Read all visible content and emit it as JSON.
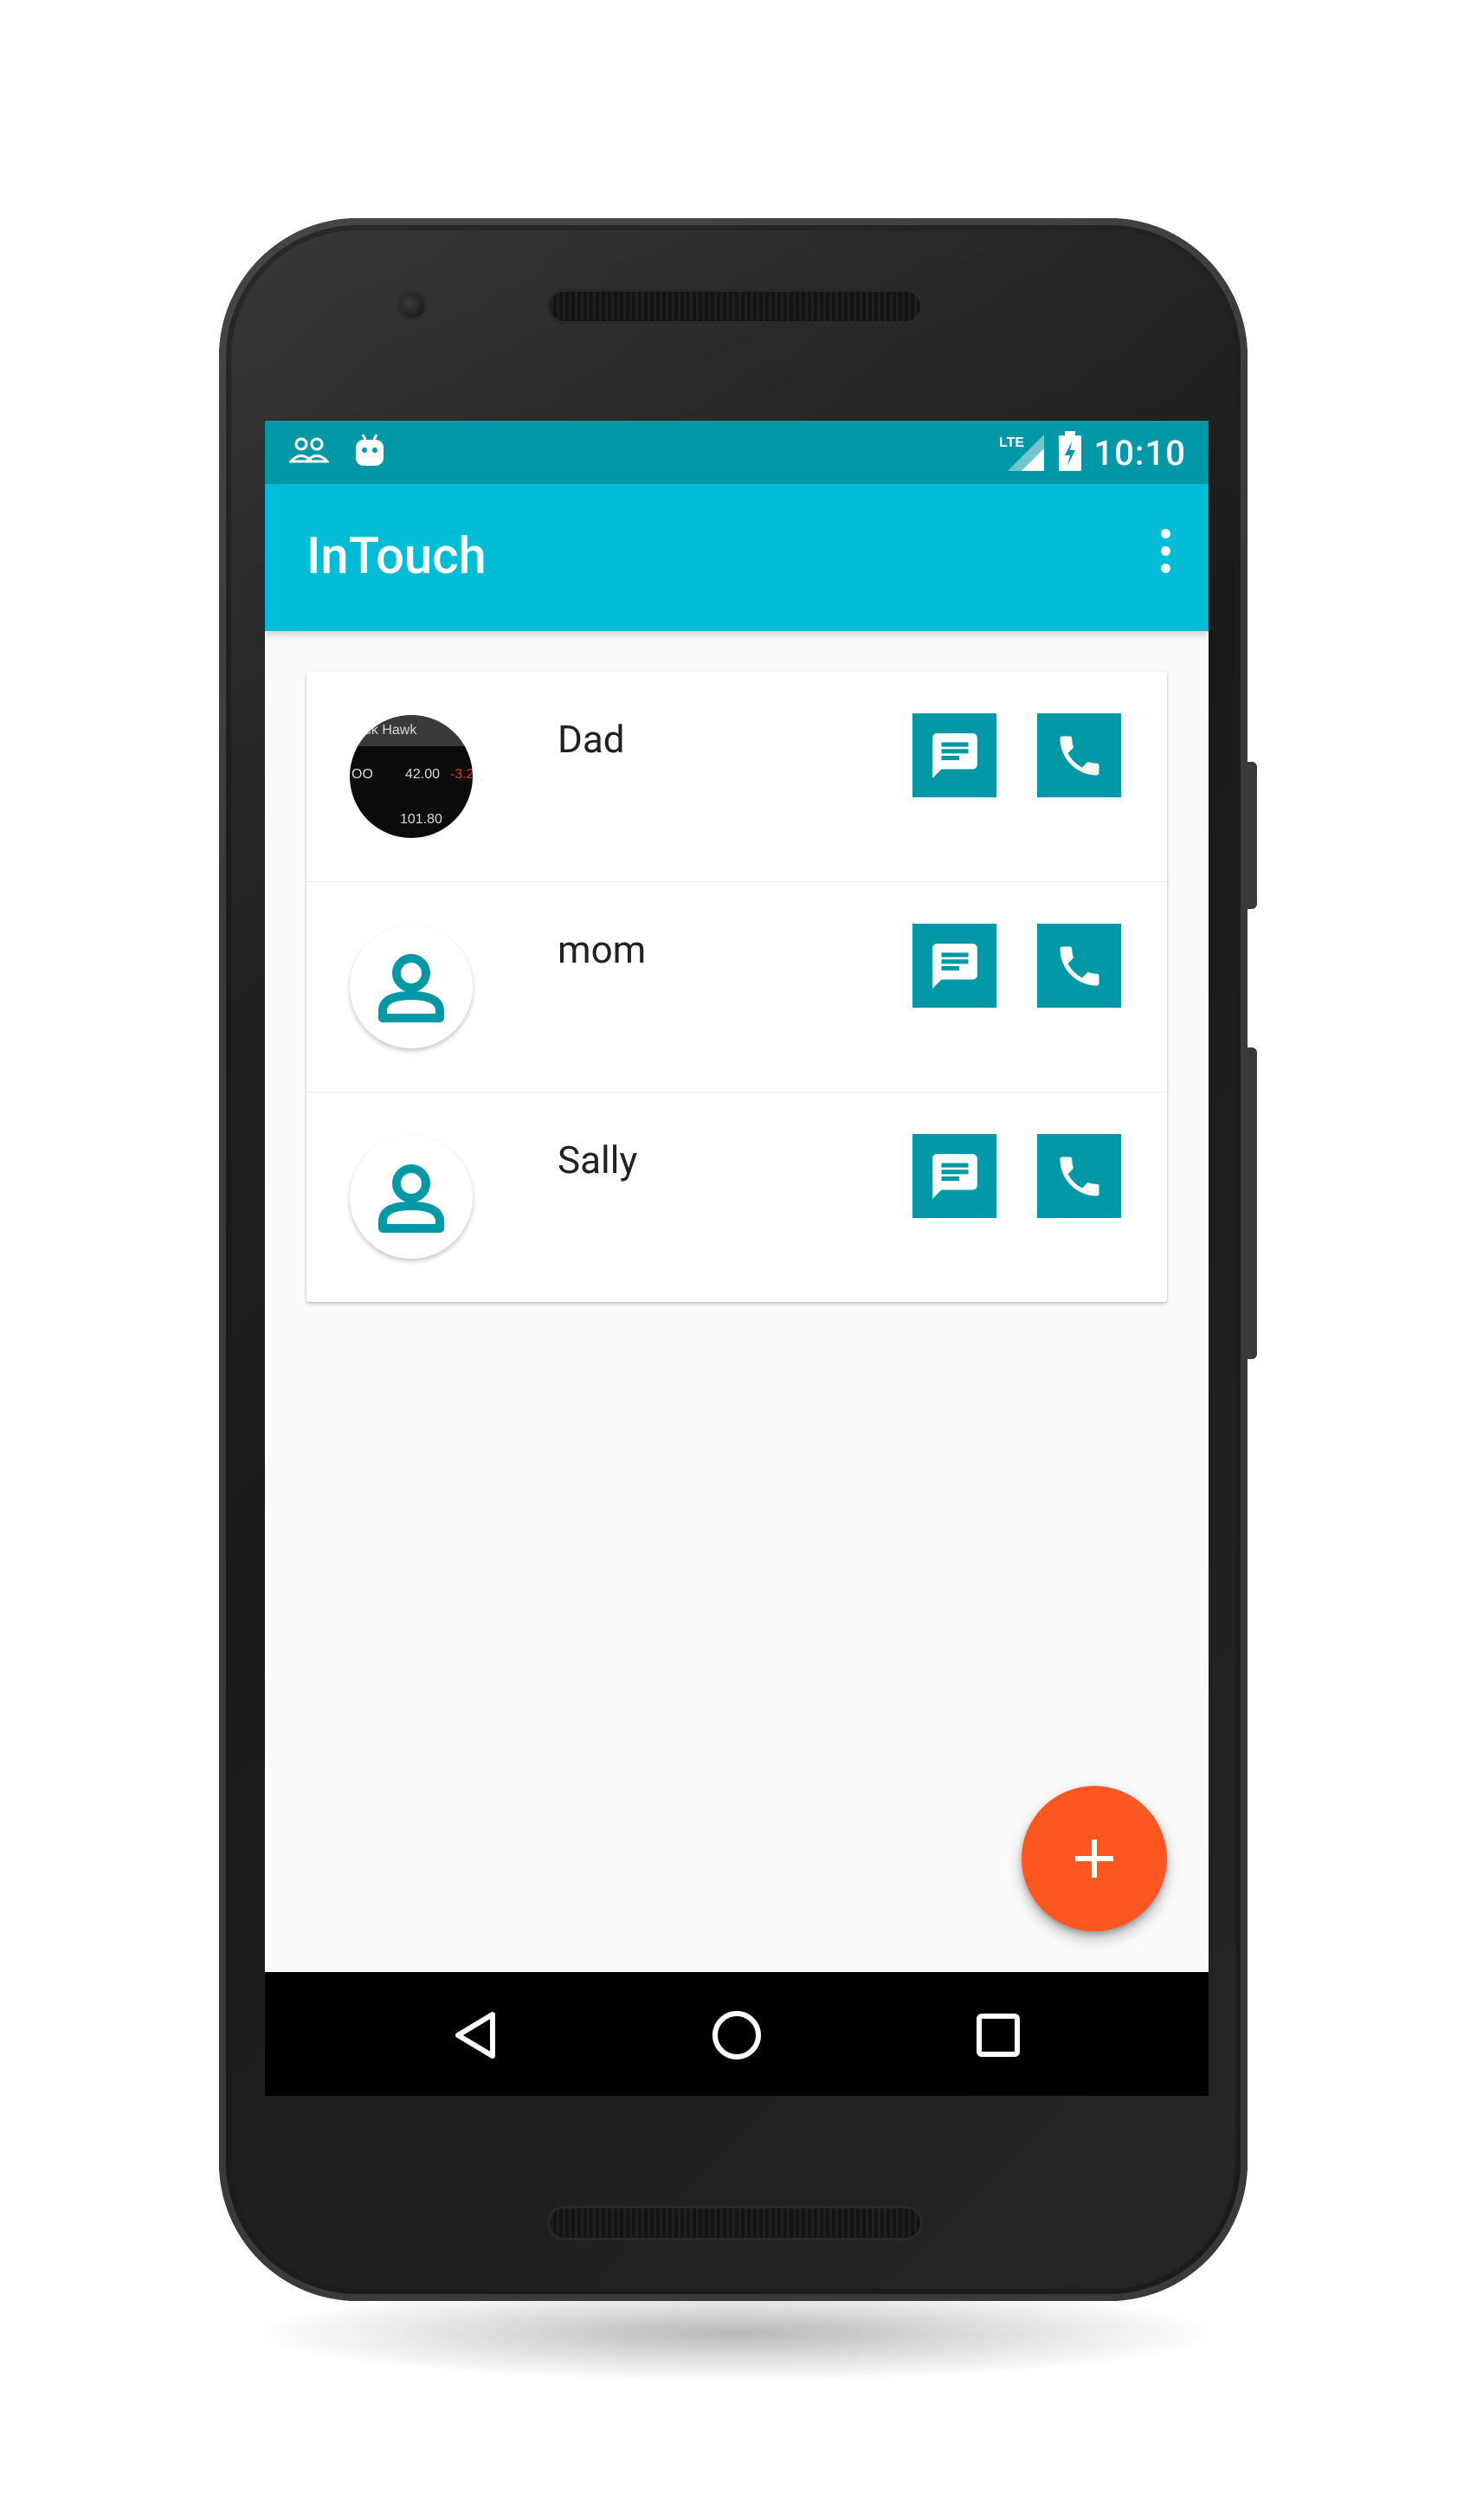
{
  "status_bar": {
    "time": "10:10",
    "network": "LTE",
    "left_icons": [
      "contacts-sync-icon",
      "android-debug-icon"
    ],
    "right_icons": [
      "lte-signal-icon",
      "battery-charging-icon"
    ]
  },
  "app_bar": {
    "title": "InTouch",
    "overflow_icon": "more-vert-icon"
  },
  "contacts": [
    {
      "name": "Dad",
      "avatar": "photo",
      "photo_text": [
        "ock Hawk",
        "OO",
        "42.00",
        "-3.2",
        "101.80"
      ]
    },
    {
      "name": "mom",
      "avatar": "default-person"
    },
    {
      "name": "Sally",
      "avatar": "default-person"
    }
  ],
  "actions": {
    "message_icon": "message-icon",
    "call_icon": "phone-icon"
  },
  "fab": {
    "label": "+",
    "icon": "add-icon"
  },
  "nav_bar": [
    "back-icon",
    "home-icon",
    "recents-icon"
  ],
  "colors": {
    "status_bar": "#0097a7",
    "app_bar": "#00bcd4",
    "action_button": "#0097a7",
    "fab": "#ff5722",
    "background": "#fafafa"
  }
}
